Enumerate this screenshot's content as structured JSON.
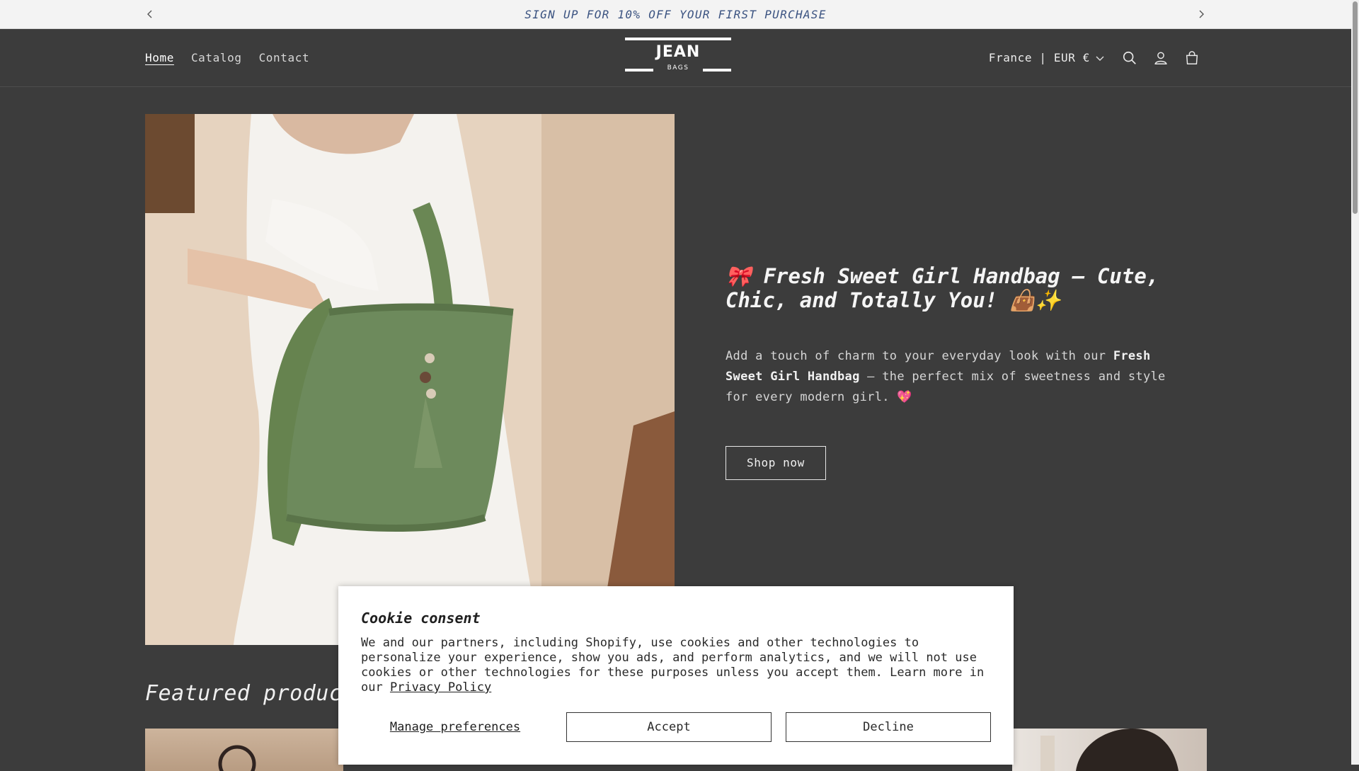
{
  "announcement": {
    "text": "SIGN UP FOR 10% OFF YOUR FIRST PURCHASE",
    "prev_icon": "chevron-left-icon",
    "next_icon": "chevron-right-icon"
  },
  "header": {
    "nav": [
      {
        "label": "Home",
        "active": true
      },
      {
        "label": "Catalog",
        "active": false
      },
      {
        "label": "Contact",
        "active": false
      }
    ],
    "logo": {
      "word": "JEAN",
      "sub": "BAGS"
    },
    "country_selector": "France | EUR €",
    "icons": [
      "search-icon",
      "account-icon",
      "cart-icon"
    ]
  },
  "hero": {
    "image_alt": "Woman holding a green crochet tote bag",
    "title": "🎀 Fresh Sweet Girl Handbag – Cute, Chic, and Totally You! 👜✨",
    "desc_before": "Add a touch of charm to your everyday look with our ",
    "desc_bold": "Fresh Sweet Girl Handbag",
    "desc_after": " – the perfect mix of sweetness and style for every modern girl. 💖",
    "button": "Shop now"
  },
  "featured": {
    "heading": "Featured products"
  },
  "cookie": {
    "title": "Cookie consent",
    "body": "We and our partners, including Shopify, use cookies and other technologies to personalize your experience, show you ads, and perform analytics, and we will not use cookies or other technologies for these purposes unless you accept them. Learn more in our ",
    "link": "Privacy Policy",
    "manage": "Manage preferences",
    "accept": "Accept",
    "decline": "Decline"
  },
  "colors": {
    "page_bg": "#3c3c3c",
    "announcement_bg": "#f3f3f3",
    "announcement_text": "#3a5280",
    "bag_green": "#6d8a5c"
  }
}
